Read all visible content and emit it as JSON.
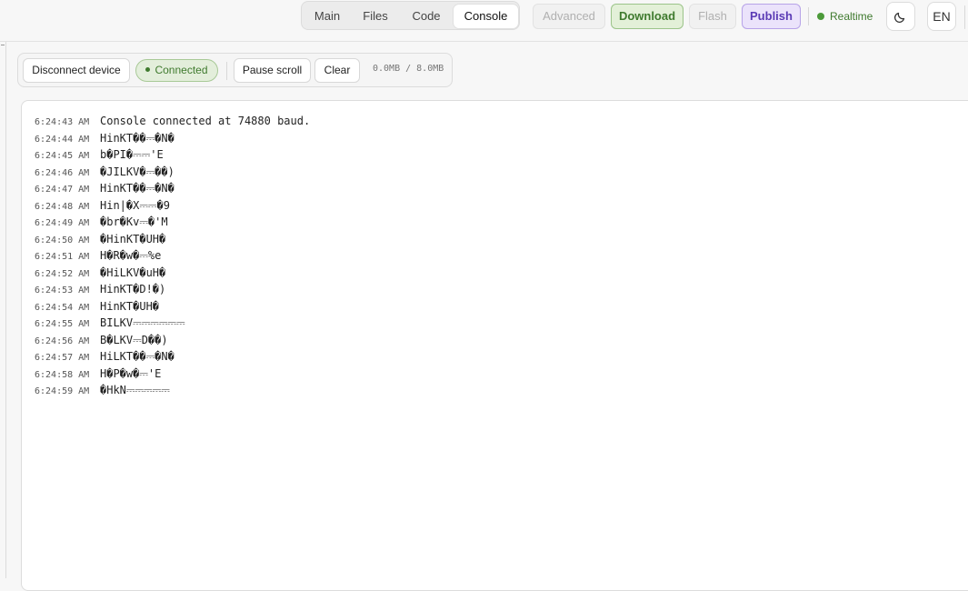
{
  "tabs": [
    "Main",
    "Files",
    "Code",
    "Console"
  ],
  "actions": {
    "advanced": "Advanced",
    "download": "Download",
    "flash": "Flash",
    "publish": "Publish"
  },
  "realtime": "Realtime",
  "language": "EN",
  "toolbar": {
    "disconnect": "Disconnect device",
    "status": "Connected",
    "pause": "Pause scroll",
    "clear": "Clear",
    "memory": "0.0MB / 8.0MB"
  },
  "log": [
    {
      "time": "6:24:43 AM",
      "text": "Console connected at 74880 baud."
    },
    {
      "time": "6:24:44 AM",
      "text": "HinKT��⎓�N�"
    },
    {
      "time": "6:24:45 AM",
      "text": "b�PI�⎓⎓'E"
    },
    {
      "time": "6:24:46 AM",
      "text": "�JILKV�⎓��)"
    },
    {
      "time": "6:24:47 AM",
      "text": "HinKT��⎓�N�"
    },
    {
      "time": "6:24:48 AM",
      "text": "Hin|�X⎓⎓�9"
    },
    {
      "time": "6:24:49 AM",
      "text": "�br�Kv⎓�'M"
    },
    {
      "time": "6:24:50 AM",
      "text": "�HinKT�UH�"
    },
    {
      "time": "6:24:51 AM",
      "text": "H�R�w�⎓%e"
    },
    {
      "time": "6:24:52 AM",
      "text": "�HiLKV�uH�"
    },
    {
      "time": "6:24:53 AM",
      "text": "HinKT�D!�)"
    },
    {
      "time": "6:24:54 AM",
      "text": "HinKT�UH�"
    },
    {
      "time": "6:24:55 AM",
      "text": "BILKV⎓⎓⎓⎓⎓⎓"
    },
    {
      "time": "6:24:56 AM",
      "text": "B�LKV⎓D��)"
    },
    {
      "time": "6:24:57 AM",
      "text": "HiLKT��⎓�N�"
    },
    {
      "time": "6:24:58 AM",
      "text": "H�P�w�⎓'E"
    },
    {
      "time": "6:24:59 AM",
      "text": "�HkN⎓⎓⎓⎓⎓"
    }
  ],
  "colors": {
    "download_accent": "#3f7a2e",
    "publish_accent": "#5b3bb5",
    "connected_accent": "#4c9a3a"
  },
  "icons": {
    "theme": "moon-icon",
    "status": "status-dot-icon"
  }
}
